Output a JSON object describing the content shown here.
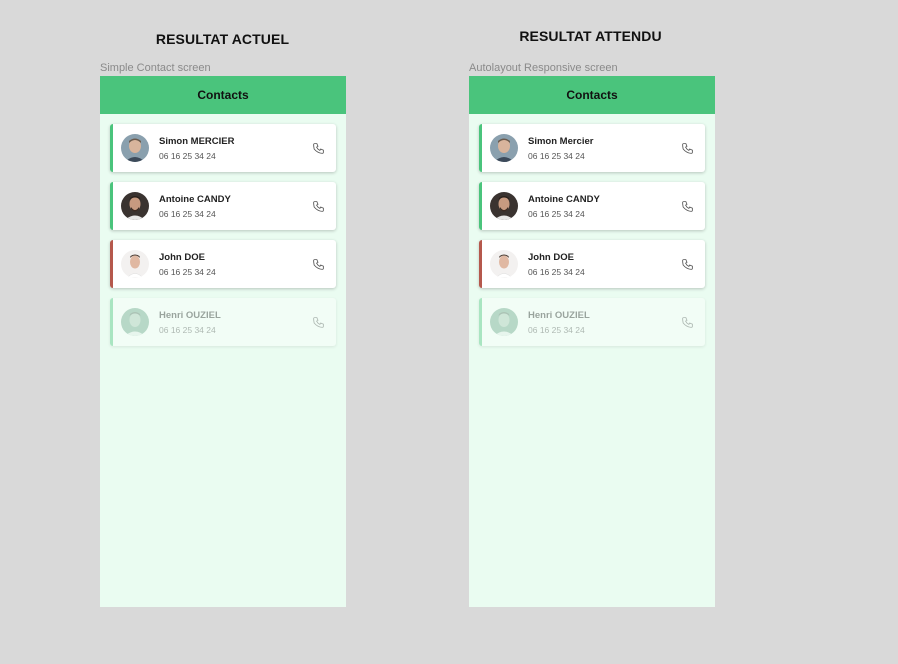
{
  "left": {
    "title": "RESULTAT ACTUEL",
    "frame_label": "Simple Contact screen",
    "header": "Contacts",
    "contacts": [
      {
        "name": "Simon MERCIER",
        "phone": "06 16 25 34 24"
      },
      {
        "name": "Antoine CANDY",
        "phone": "06 16 25 34 24"
      },
      {
        "name": "John DOE",
        "phone": "06 16 25 34 24"
      },
      {
        "name": "Henri OUZIEL",
        "phone": "06 16 25 34 24"
      }
    ]
  },
  "right": {
    "title": "RESULTAT ATTENDU",
    "frame_label": "Autolayout Responsive screen",
    "header": "Contacts",
    "contacts": [
      {
        "name": "Simon Mercier",
        "phone": "06 16 25 34 24"
      },
      {
        "name": "Antoine CANDY",
        "phone": "06 16 25 34 24"
      },
      {
        "name": "John DOE",
        "phone": "06 16 25 34 24"
      },
      {
        "name": "Henri OUZIEL",
        "phone": "06 16 25 34 24"
      }
    ]
  },
  "colors": {
    "accent_green": "#4ac47c",
    "accent_red": "#b5584c",
    "screen_background": "#eafcf1"
  },
  "icons": {
    "call": "phone-icon"
  }
}
